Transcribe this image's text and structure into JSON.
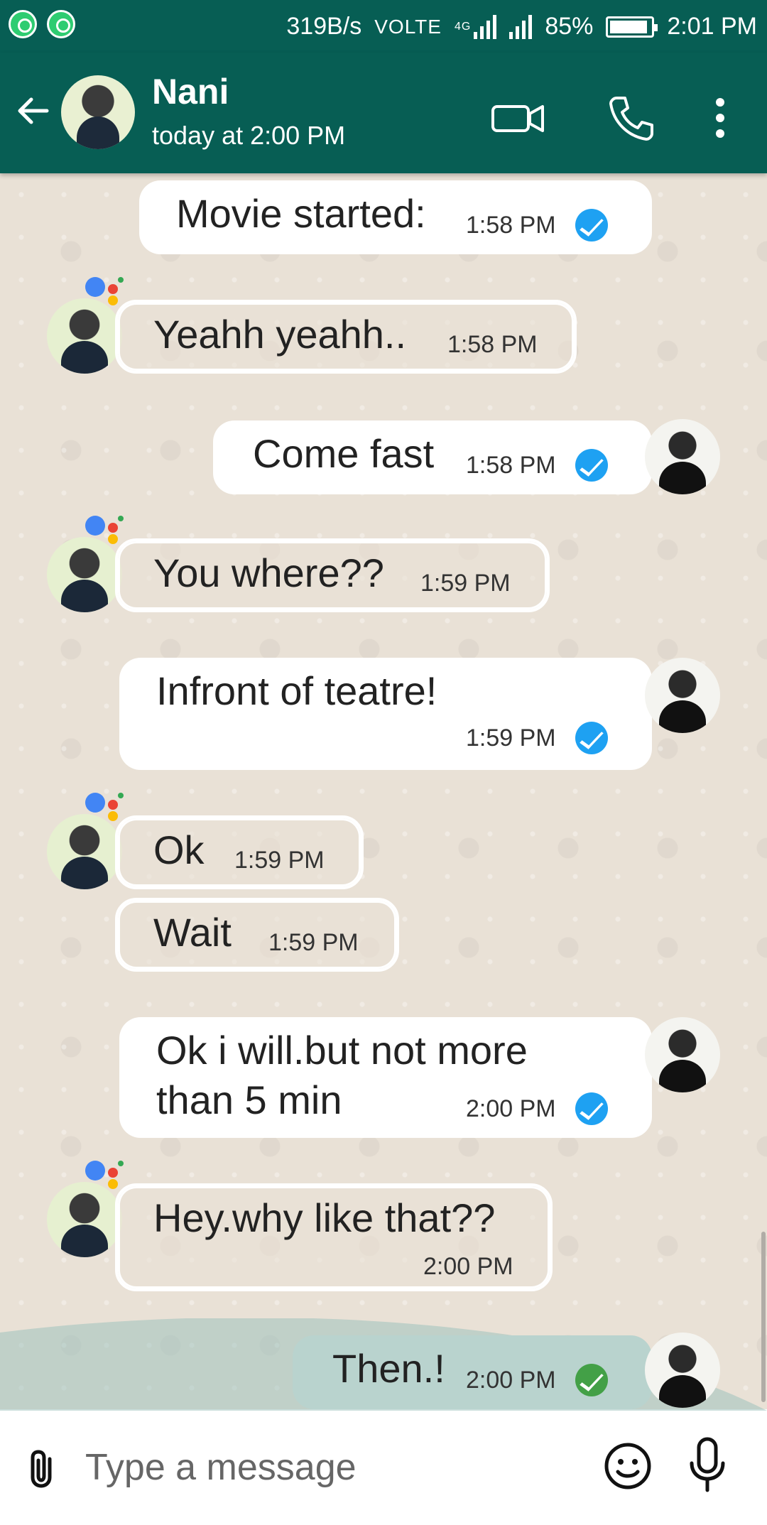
{
  "status_bar": {
    "speed": "319B/s",
    "volte": "VOLTE",
    "network": "4G",
    "battery": "85%",
    "time": "2:01 PM"
  },
  "header": {
    "name": "Nani",
    "status": "today at 2:00 PM",
    "icons": [
      "back-arrow-icon",
      "video-call-icon",
      "phone-icon",
      "more-vert-icon"
    ]
  },
  "messages": [
    {
      "direction": "out",
      "text": "Movie started:",
      "time": "1:58 PM",
      "status": "sent"
    },
    {
      "direction": "in",
      "text": "Yeahh yeahh..",
      "time": "1:58 PM"
    },
    {
      "direction": "out",
      "text": "Come fast",
      "time": "1:58 PM",
      "status": "sent"
    },
    {
      "direction": "in",
      "text": "You where??",
      "time": "1:59 PM"
    },
    {
      "direction": "out",
      "text": "Infront of teatre!",
      "time": "1:59 PM",
      "status": "sent"
    },
    {
      "direction": "in",
      "text": "Ok",
      "time": "1:59 PM"
    },
    {
      "direction": "in",
      "text": "Wait",
      "time": "1:59 PM"
    },
    {
      "direction": "out",
      "text": "Ok i will.but not more",
      "text2": "than 5 min",
      "time": "2:00 PM",
      "status": "sent"
    },
    {
      "direction": "in",
      "text": "Hey.why like that??",
      "time": "2:00 PM"
    },
    {
      "direction": "out",
      "text": "Then.!",
      "time": "2:00 PM",
      "status": "read"
    }
  ],
  "input": {
    "placeholder": "Type a message"
  },
  "colors": {
    "header": "#075e54",
    "tick_blue": "#1ea1f2",
    "tick_green": "#43a047",
    "wave": "#9fc3bd"
  }
}
